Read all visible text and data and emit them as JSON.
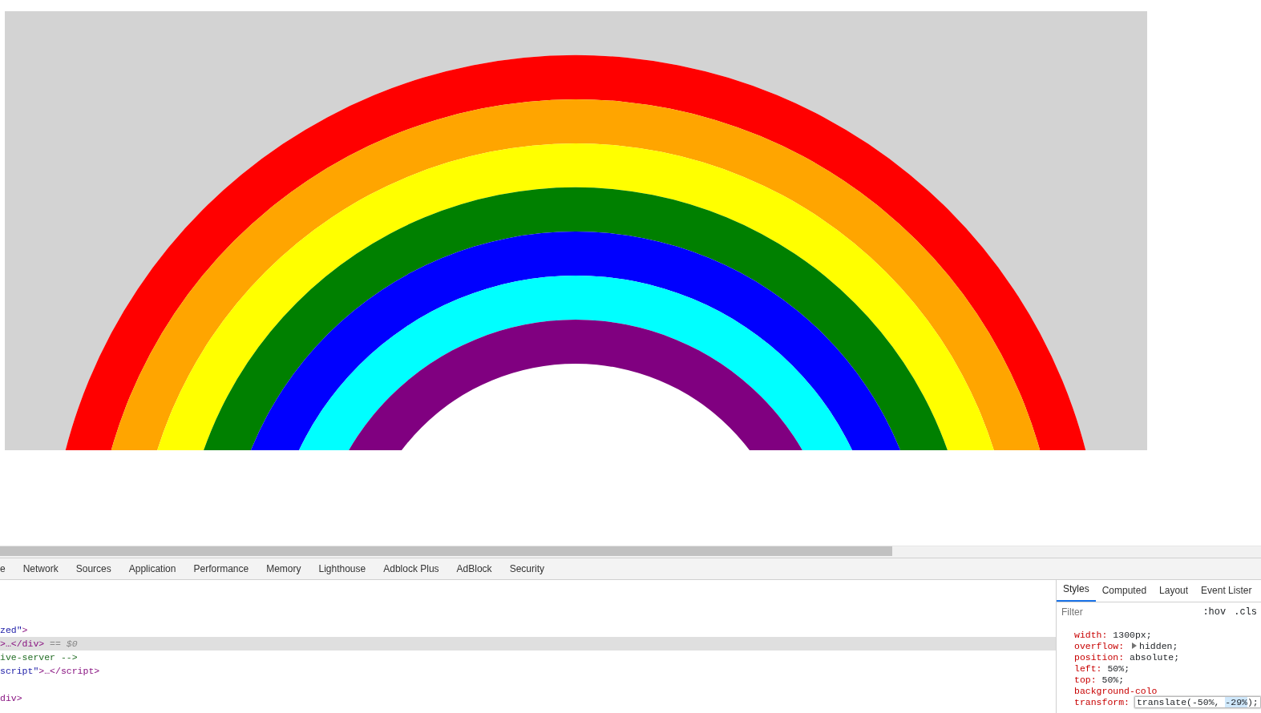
{
  "devtools_tabs": [
    {
      "label": "e"
    },
    {
      "label": "Network"
    },
    {
      "label": "Sources"
    },
    {
      "label": "Application"
    },
    {
      "label": "Performance"
    },
    {
      "label": "Memory"
    },
    {
      "label": "Lighthouse"
    },
    {
      "label": "Adblock Plus"
    },
    {
      "label": "AdBlock"
    },
    {
      "label": "Security"
    }
  ],
  "elements": [
    {
      "selected": false,
      "segments": [
        {
          "kind": "value",
          "text": "zed\""
        },
        {
          "kind": "tag",
          "text": ">"
        }
      ]
    },
    {
      "selected": true,
      "segments": [
        {
          "kind": "tag",
          "text": ">…</div>"
        },
        {
          "kind": "note",
          "text": " == $0"
        }
      ]
    },
    {
      "selected": false,
      "segments": [
        {
          "kind": "comment",
          "text": "ive-server -->"
        }
      ]
    },
    {
      "selected": false,
      "segments": [
        {
          "kind": "value",
          "text": "script\""
        },
        {
          "kind": "tag",
          "text": ">…</script>"
        }
      ]
    },
    {
      "selected": false,
      "segments": [
        {
          "kind": "tag",
          "text": "div>"
        }
      ]
    }
  ],
  "sidebar_tabs": [
    {
      "label": "Styles",
      "selected": true
    },
    {
      "label": "Computed",
      "selected": false
    },
    {
      "label": "Layout",
      "selected": false
    },
    {
      "label": "Event Lister",
      "selected": false
    }
  ],
  "filter": {
    "placeholder": "Filter"
  },
  "toggles": [
    ":hov",
    ".cls"
  ],
  "declarations": [
    {
      "property": "width:",
      "value": "1300px;",
      "expandable": false
    },
    {
      "property": "overflow:",
      "value": "hidden;",
      "expandable": true
    },
    {
      "property": "position:",
      "value": "absolute;",
      "expandable": false
    },
    {
      "property": "left:",
      "value": "50%;",
      "expandable": false
    },
    {
      "property": "top:",
      "value": "50%;",
      "expandable": false
    }
  ],
  "cut_property": "background-colo",
  "editing": {
    "property": "transform:",
    "before": "translate(-50%, ",
    "selection": "-29%",
    "after": ");"
  }
}
